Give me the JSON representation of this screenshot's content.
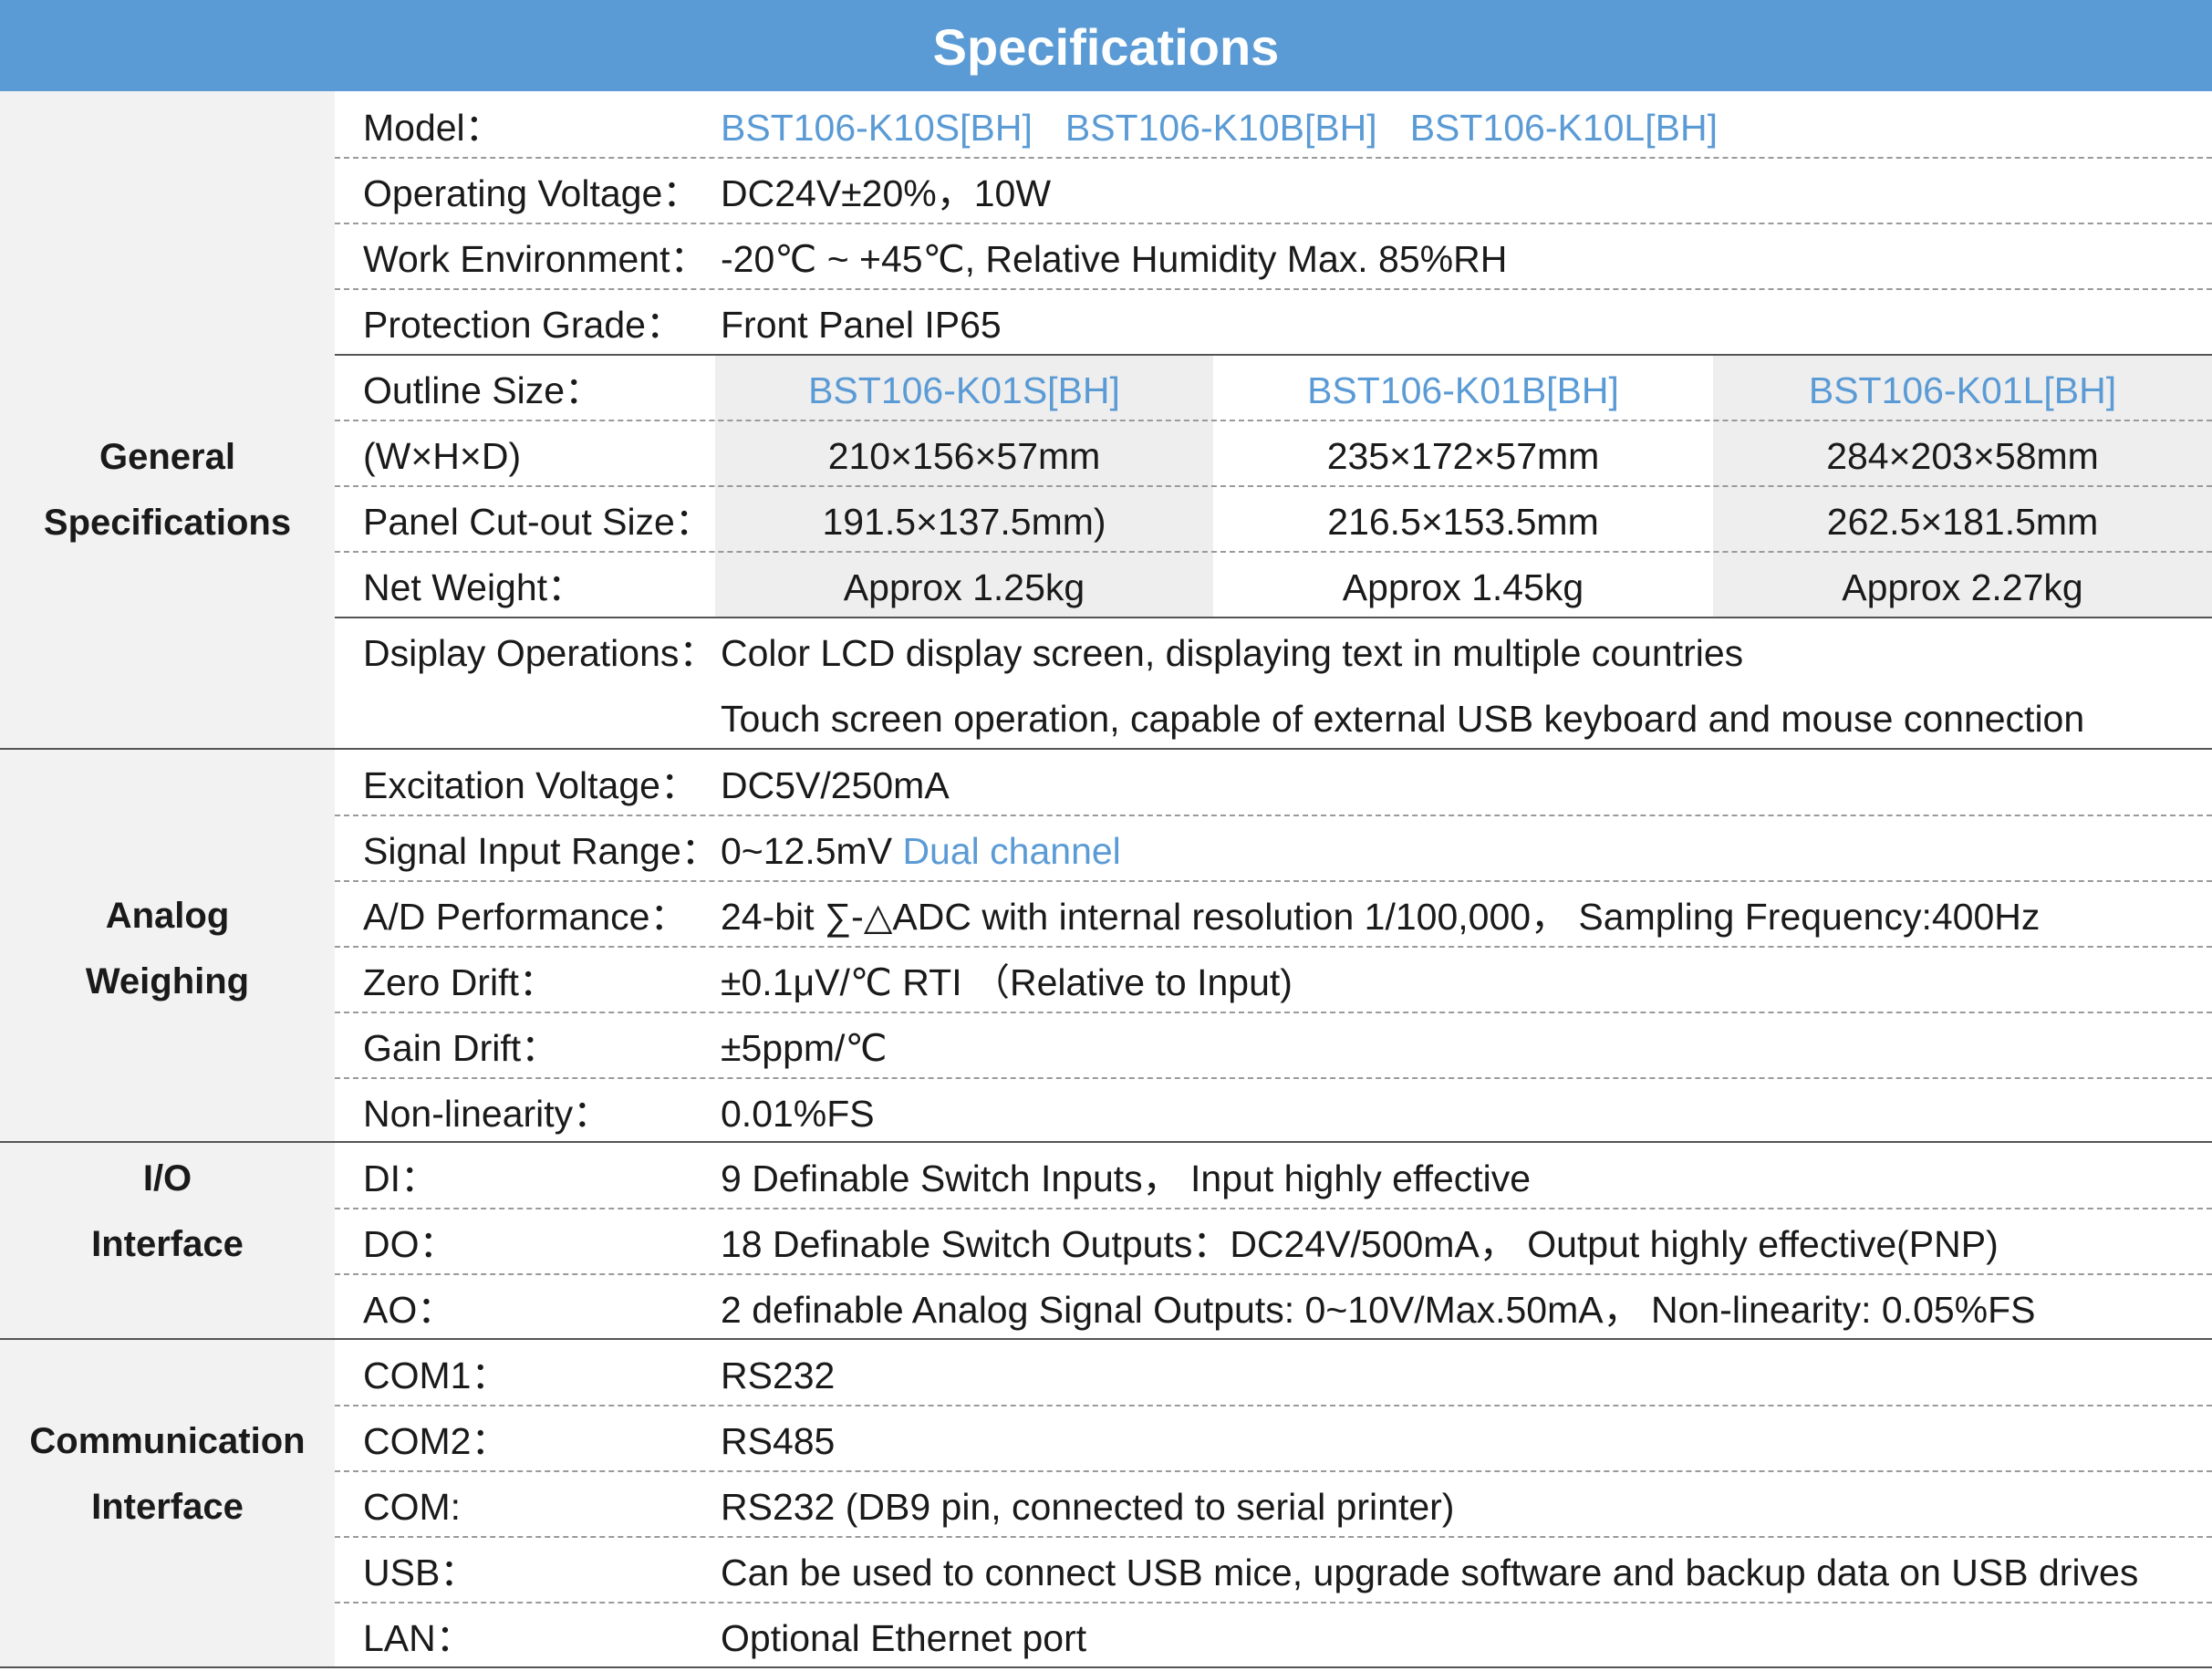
{
  "title": "Specifications",
  "sections": {
    "general": {
      "label_line1": "General",
      "label_line2": "Specifications",
      "model": {
        "label": "Model：",
        "values": [
          "BST106-K10S[BH]",
          "BST106-K10B[BH]",
          "BST106-K10L[BH]"
        ]
      },
      "voltage": {
        "label": "Operating Voltage：",
        "value": "DC24V±20%，10W"
      },
      "environment": {
        "label": "Work Environment：",
        "value": "-20℃ ~ +45℃, Relative Humidity Max. 85%RH"
      },
      "protection": {
        "label": "Protection Grade：",
        "value": "Front Panel  IP65"
      },
      "outline": {
        "label": "Outline Size：",
        "columns": [
          "BST106-K01S[BH]",
          "BST106-K01B[BH]",
          "BST106-K01L[BH]"
        ]
      },
      "dimensions": {
        "label": "(W×H×D)",
        "columns": [
          "210×156×57mm",
          "235×172×57mm",
          "284×203×58mm"
        ]
      },
      "cutout": {
        "label": "Panel Cut-out Size：",
        "columns": [
          "191.5×137.5mm)",
          "216.5×153.5mm",
          "262.5×181.5mm"
        ]
      },
      "weight": {
        "label": "Net Weight：",
        "columns": [
          "Approx  1.25kg",
          "Approx 1.45kg",
          "Approx  2.27kg"
        ]
      },
      "display": {
        "label": "Dsiplay Operations：",
        "line1": "Color LCD display screen, displaying text in multiple countries",
        "line2": "Touch screen operation, capable of external USB keyboard and mouse connection"
      }
    },
    "analog": {
      "label_line1": "Analog",
      "label_line2": "Weighing",
      "excitation": {
        "label": "Excitation Voltage：",
        "value": "DC5V/250mA"
      },
      "signal": {
        "label": "Signal Input Range：",
        "value": "0~12.5mV",
        "extra": "Dual channel"
      },
      "ad": {
        "label": "A/D Performance：",
        "value": "24-bit ∑-△ADC with internal resolution 1/100,000， Sampling Frequency:400Hz"
      },
      "zero": {
        "label": "Zero Drift：",
        "value": "±0.1μV/℃ RTI （Relative to Input)"
      },
      "gain": {
        "label": "Gain Drift：",
        "value": "±5ppm/℃"
      },
      "nonlin": {
        "label": "Non-linearity：",
        "value": "0.01%FS"
      }
    },
    "io": {
      "label_line1": "I/O",
      "label_line2": "Interface",
      "di": {
        "label": "DI：",
        "value": "9 Definable  Switch Inputs， Input highly effective"
      },
      "do": {
        "label": "DO：",
        "value": "18 Definable  Switch Outputs：DC24V/500mA， Output highly effective(PNP)"
      },
      "ao": {
        "label": "AO：",
        "value": "2 definable Analog Signal Outputs: 0~10V/Max.50mA，  Non-linearity: 0.05%FS"
      }
    },
    "comm": {
      "label_line1": "Communication",
      "label_line2": "Interface",
      "com1": {
        "label": "COM1：",
        "value": "RS232"
      },
      "com2": {
        "label": "COM2：",
        "value": "RS485"
      },
      "com": {
        "label": "COM:",
        "value": "RS232 (DB9 pin, connected to serial printer)"
      },
      "usb": {
        "label": "USB：",
        "value": "Can be used to connect USB mice, upgrade software  and backup data on USB drives"
      },
      "lan": {
        "label": "LAN：",
        "value": "Optional Ethernet port"
      }
    }
  },
  "colors": {
    "accent": "#5b9bd5",
    "section_bg": "#f2f2f2",
    "column_bg": "#eeeeee"
  }
}
